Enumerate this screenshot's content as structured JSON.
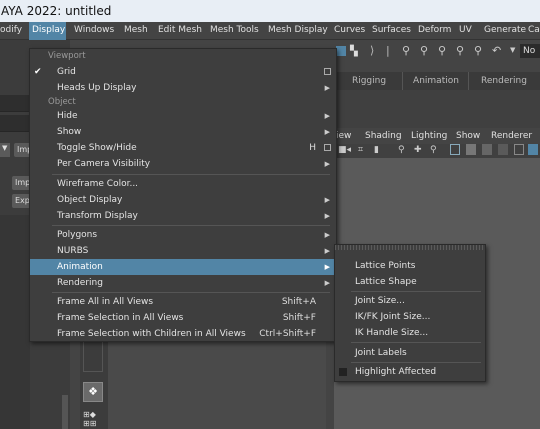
{
  "window": {
    "title": "AYA 2022: untitled"
  },
  "menubar": {
    "items": [
      "odify",
      "Display",
      "Windows",
      "Mesh",
      "Edit Mesh",
      "Mesh Tools",
      "Mesh Display",
      "Curves",
      "Surfaces",
      "Deform",
      "UV",
      "Generate",
      "Ca"
    ],
    "active": "Display"
  },
  "left_panel": {
    "buttons": [
      "Imp",
      "Imp",
      "Exp"
    ]
  },
  "shelf": {
    "tabs": [
      "Rigging",
      "Animation",
      "Rendering"
    ],
    "search_label": "No"
  },
  "viewport": {
    "menus": [
      "iew",
      "Shading",
      "Lighting",
      "Show",
      "Renderer"
    ]
  },
  "display_menu": {
    "sections": [
      "Viewport",
      "Object"
    ],
    "items": [
      {
        "label": "Grid",
        "checked": true,
        "option_box": true
      },
      {
        "label": "Heads Up Display",
        "submenu": true
      },
      {
        "label": "Hide",
        "submenu": true
      },
      {
        "label": "Show",
        "submenu": true
      },
      {
        "label": "Toggle Show/Hide",
        "shortcut": "H",
        "option_box": true
      },
      {
        "label": "Per Camera Visibility",
        "submenu": true
      },
      {
        "label": "Wireframe Color..."
      },
      {
        "label": "Object Display",
        "submenu": true
      },
      {
        "label": "Transform Display",
        "submenu": true
      },
      {
        "label": "Polygons",
        "submenu": true
      },
      {
        "label": "NURBS",
        "submenu": true
      },
      {
        "label": "Animation",
        "submenu": true,
        "highlighted": true
      },
      {
        "label": "Rendering",
        "submenu": true
      },
      {
        "label": "Frame All in All Views",
        "shortcut": "Shift+A"
      },
      {
        "label": "Frame Selection in All Views",
        "shortcut": "Shift+F"
      },
      {
        "label": "Frame Selection with Children in All Views",
        "shortcut": "Ctrl+Shift+F"
      }
    ]
  },
  "animation_submenu": {
    "items": [
      "Lattice Points",
      "Lattice Shape",
      "Joint Size...",
      "IK/FK Joint Size...",
      "IK Handle Size...",
      "Joint Labels",
      "Highlight Affected"
    ]
  },
  "colors": {
    "highlight": "#5285a6",
    "menu_bg": "#3e3e3e"
  }
}
